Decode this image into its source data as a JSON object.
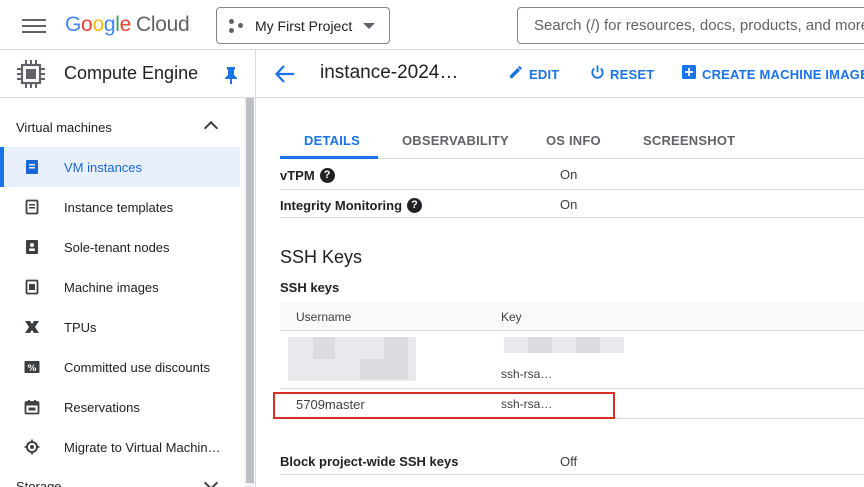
{
  "topbar": {
    "logo_google": "Google",
    "logo_cloud": "Cloud",
    "project": "My First Project",
    "search_placeholder": "Search (/) for resources, docs, products, and more"
  },
  "sidebar": {
    "title": "Compute Engine",
    "section": "Virtual machines",
    "items": [
      {
        "label": "VM instances",
        "icon": "vm-instance-icon",
        "active": true
      },
      {
        "label": "Instance templates",
        "icon": "template-icon"
      },
      {
        "label": "Sole-tenant nodes",
        "icon": "sole-tenant-icon"
      },
      {
        "label": "Machine images",
        "icon": "machine-image-icon"
      },
      {
        "label": "TPUs",
        "icon": "tpu-icon"
      },
      {
        "label": "Committed use discounts",
        "icon": "percent-icon"
      },
      {
        "label": "Reservations",
        "icon": "calendar-icon"
      },
      {
        "label": "Migrate to Virtual Machin…",
        "icon": "migrate-icon"
      }
    ],
    "storage": "Storage"
  },
  "header": {
    "instance_title": "instance-2024…",
    "edit": "EDIT",
    "reset": "RESET",
    "create_image": "CREATE MACHINE IMAGE"
  },
  "tabs": [
    "DETAILS",
    "OBSERVABILITY",
    "OS INFO",
    "SCREENSHOT"
  ],
  "details": {
    "vtpm_label": "vTPM",
    "vtpm_value": "On",
    "integrity_label": "Integrity Monitoring",
    "integrity_value": "On",
    "help_glyph": "?"
  },
  "ssh": {
    "heading": "SSH Keys",
    "subheading": "SSH keys",
    "col_username": "Username",
    "col_key": "Key",
    "rows": [
      {
        "username": "",
        "key": "ssh-rsa…"
      },
      {
        "username": "5709master",
        "key": "ssh-rsa…"
      }
    ],
    "block_label": "Block project-wide SSH keys",
    "block_value": "Off"
  },
  "colors": {
    "accent": "#1a73e8",
    "highlight": "#d93025"
  }
}
